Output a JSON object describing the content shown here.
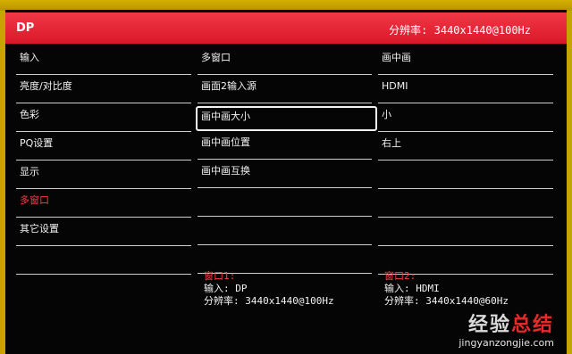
{
  "header": {
    "title": "DP",
    "resolution": "分辨率: 3440x1440@100Hz"
  },
  "menu": {
    "items": [
      "输入",
      "亮度/对比度",
      "色彩",
      "PQ设置",
      "显示",
      "多窗口",
      "其它设置",
      ""
    ],
    "active_item": "多窗口"
  },
  "submenu": {
    "items": [
      "多窗口",
      "画面2输入源",
      "画中画大小",
      "画中画位置",
      "画中画互换",
      "",
      "",
      ""
    ],
    "selected_item": "画中画大小"
  },
  "values": {
    "items": [
      "画中画",
      "HDMI",
      "小",
      "右上",
      "",
      "",
      "",
      ""
    ]
  },
  "window1": {
    "title": "窗口1:",
    "input": "输入:  DP",
    "resolution": "分辨率: 3440x1440@100Hz"
  },
  "window2": {
    "title": "窗口2:",
    "input": "输入:  HDMI",
    "resolution": "分辨率: 3440x1440@60Hz"
  },
  "watermark": {
    "text_white": "经验",
    "text_red": "总结",
    "sub": "jingyanzongjie.com"
  },
  "colors": {
    "header": "#e82a3a",
    "active": "#ff3b45",
    "text": "#f2f2f2",
    "background": "#050505"
  }
}
